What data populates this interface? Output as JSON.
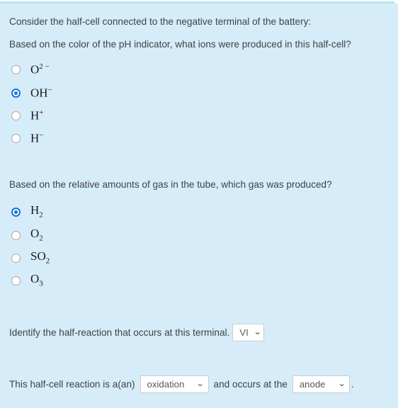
{
  "theme": {
    "background": "#d6ecf8",
    "accent_bar": "#b5e6f2",
    "text": "#3e4347",
    "radio_selected": "#1574e0",
    "select_border": "#c8cdd1"
  },
  "prompts": {
    "intro": "Consider the half-cell connected to the negative terminal of the battery:",
    "question1": "Based on the color of the pH indicator, what ions were produced in this half-cell?",
    "question2": "Based on the relative amounts of gas in the tube, which gas was produced?"
  },
  "question1_options": [
    {
      "base": "O",
      "sup": "2 −",
      "sub": "",
      "selected": false
    },
    {
      "base": "OH",
      "sup": "−",
      "sub": "",
      "selected": true
    },
    {
      "base": "H",
      "sup": "+",
      "sub": "",
      "selected": false
    },
    {
      "base": "H",
      "sup": "−",
      "sub": "",
      "selected": false
    }
  ],
  "question2_options": [
    {
      "base": "H",
      "sup": "",
      "sub": "2",
      "selected": true
    },
    {
      "base": "O",
      "sup": "",
      "sub": "2",
      "selected": false
    },
    {
      "base": "SO",
      "sup": "",
      "sub": "2",
      "selected": false
    },
    {
      "base": "O",
      "sup": "",
      "sub": "3",
      "selected": false
    }
  ],
  "half_reaction_row": {
    "label": "Identify the half-reaction that occurs at this terminal.",
    "select_value": "VI",
    "chevron": "⌄"
  },
  "summary_row": {
    "text_before": "This half-cell reaction is a(an)",
    "reaction_type_value": "oxidation",
    "text_middle": "and occurs at the",
    "electrode_value": "anode",
    "text_after": ".",
    "chevron": "⌄"
  }
}
